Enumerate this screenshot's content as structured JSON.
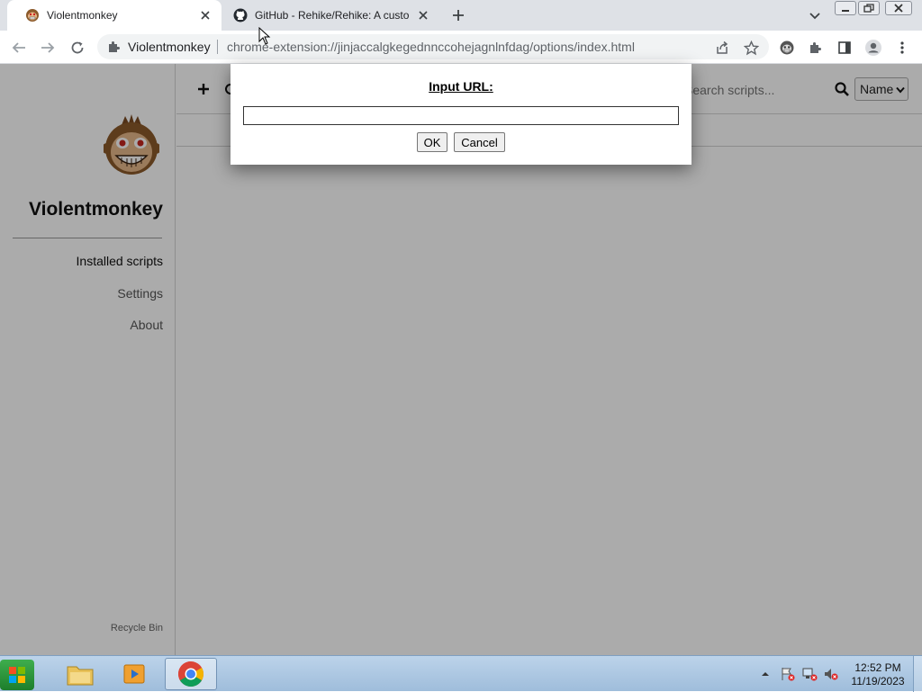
{
  "browser": {
    "tabs": [
      {
        "title": "Violentmonkey",
        "active": true
      },
      {
        "title": "GitHub - Rehike/Rehike: A custo",
        "active": false
      }
    ],
    "omnibox": {
      "origin_label": "Violentmonkey",
      "url": "chrome-extension://jinjaccalgkegednnccohejagnlnfdag/options/index.html"
    },
    "icons": {
      "new_tab": "plus-icon",
      "tab_list": "chevron-down-icon",
      "back": "arrow-left-icon",
      "forward": "arrow-right-icon",
      "reload": "reload-icon",
      "share": "share-icon",
      "bookmark": "star-icon",
      "extension_violentmonkey": "violentmonkey-icon",
      "extensions": "puzzle-icon",
      "side_panel": "side-panel-icon",
      "profile": "profile-icon",
      "menu": "kebab-menu-icon"
    }
  },
  "app": {
    "brand": "Violentmonkey",
    "nav": [
      {
        "label": "Installed scripts",
        "active": true
      },
      {
        "label": "Settings",
        "active": false
      },
      {
        "label": "About",
        "active": false
      }
    ],
    "recycle_bin": "Recycle Bin",
    "search": {
      "placeholder": "Search scripts..."
    },
    "sort": {
      "selected": "Name"
    }
  },
  "dialog": {
    "title": "Input URL:",
    "input_value": "",
    "ok_label": "OK",
    "cancel_label": "Cancel"
  },
  "taskbar": {
    "time": "12:52 PM",
    "date": "11/19/2023"
  },
  "colors": {
    "chrome_tabstrip": "#dee1e6",
    "overlay": "rgba(0,0,0,0.33)",
    "monkey_brown": "#8b5a2b",
    "taskbar": "#bcd3ea"
  }
}
